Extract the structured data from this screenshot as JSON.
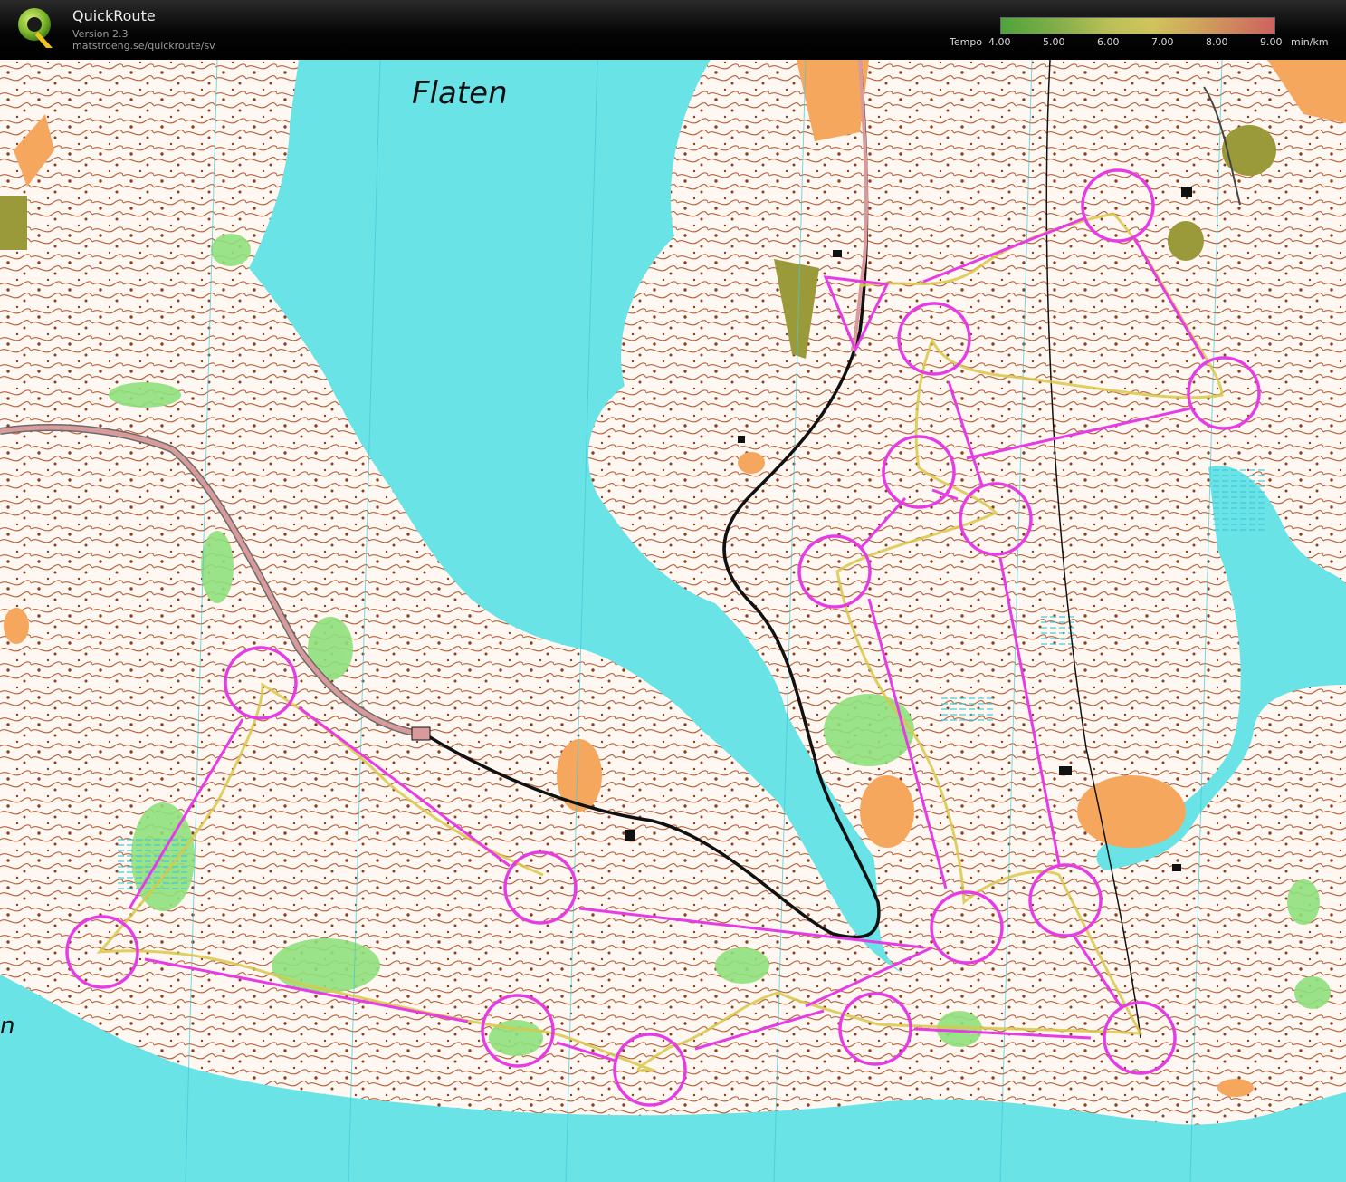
{
  "app": {
    "title": "QuickRoute",
    "version": "Version 2.3",
    "url": "matstroeng.se/quickroute/sv",
    "logo_letter": "Q"
  },
  "legend": {
    "label": "Tempo",
    "unit": "min/km",
    "ticks": [
      "4.00",
      "5.00",
      "6.00",
      "7.00",
      "8.00",
      "9.00"
    ]
  },
  "map": {
    "place_name": "Flaten",
    "edge_text": "n",
    "colors": {
      "water": "#69e3e6",
      "forest": "#ffffff",
      "contour": "#b45a32",
      "green": "#8fe07c",
      "open_land": "#f6a75e",
      "course": "#e63ce6",
      "route": "#d8c84a"
    },
    "course": {
      "start": "start-triangle",
      "controls": 15
    }
  }
}
